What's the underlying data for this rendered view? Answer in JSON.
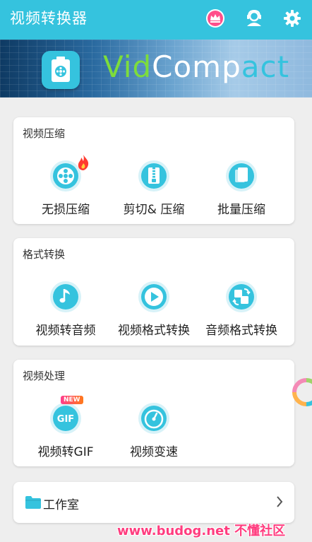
{
  "app": {
    "title": "视频转换器"
  },
  "toolbar": {
    "icons": [
      "crown-icon",
      "support-agent-icon",
      "settings-gear-icon"
    ]
  },
  "banner": {
    "brand_part1": "Vid",
    "brand_part2": "Comp",
    "brand_part3": "act"
  },
  "sections": [
    {
      "title": "视频压缩",
      "items": [
        {
          "label": "无损压缩",
          "icon": "film-reel-icon",
          "badge": "hot-flame"
        },
        {
          "label": "剪切& 压缩",
          "icon": "zip-file-icon"
        },
        {
          "label": "批量压缩",
          "icon": "stack-files-icon"
        }
      ]
    },
    {
      "title": "格式转换",
      "items": [
        {
          "label": "视频转音频",
          "icon": "music-note-icon"
        },
        {
          "label": "视频格式转换",
          "icon": "play-icon"
        },
        {
          "label": "音频格式转换",
          "icon": "convert-arrows-icon"
        }
      ]
    },
    {
      "title": "视频处理",
      "items": [
        {
          "label": "视频转GIF",
          "icon": "gif-icon",
          "badge": "NEW"
        },
        {
          "label": "视频变速",
          "icon": "speedometer-icon"
        }
      ]
    }
  ],
  "workshop": {
    "label": "工作室",
    "icon": "folder-icon"
  },
  "watermark": {
    "text": "www.budog.net 不懂社区"
  },
  "colors": {
    "primary": "#35c3de",
    "brand_green": "#7ddd3b",
    "watermark": "#ff3d7f"
  }
}
